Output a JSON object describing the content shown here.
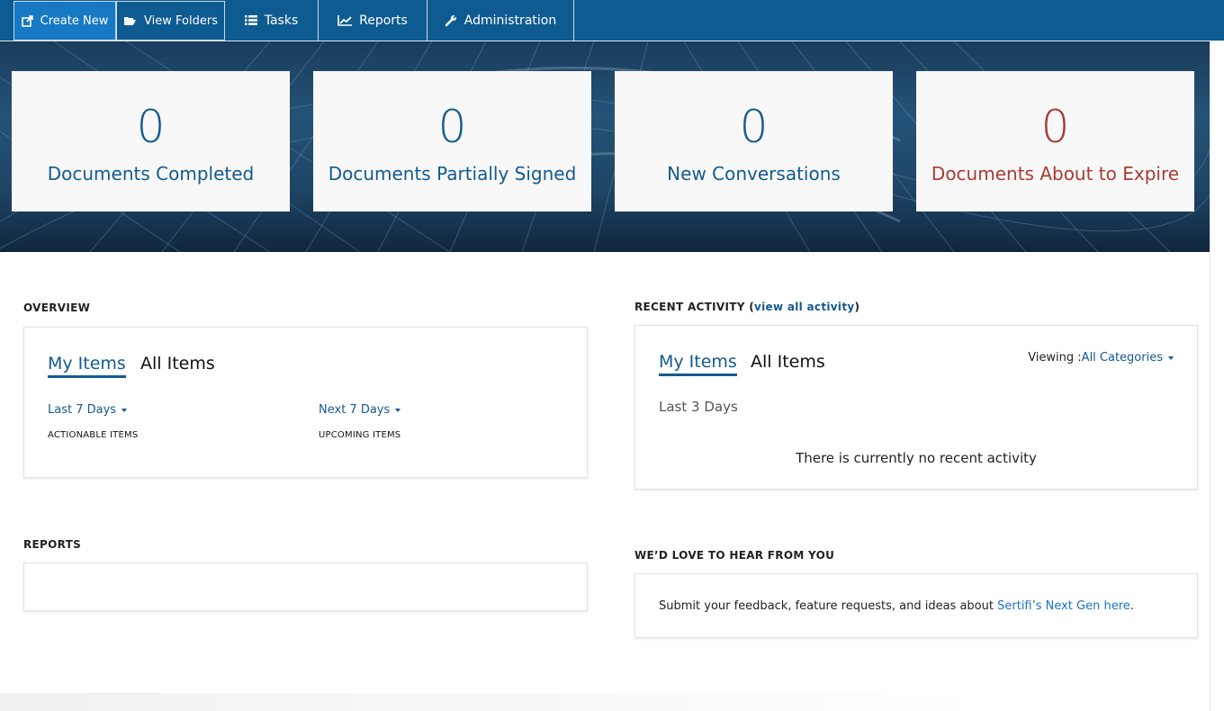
{
  "nav": {
    "create_new": "Create New",
    "view_folders": "View Folders",
    "tasks": "Tasks",
    "reports": "Reports",
    "administration": "Administration"
  },
  "stats": [
    {
      "value": "0",
      "label": "Documents Completed"
    },
    {
      "value": "0",
      "label": "Documents Partially Signed"
    },
    {
      "value": "0",
      "label": "New Conversations"
    },
    {
      "value": "0",
      "label": "Documents About to Expire"
    }
  ],
  "overview": {
    "title": "OVERVIEW",
    "tab_my": "My Items",
    "tab_all": "All Items",
    "range_left": "Last 7 Days",
    "range_right": "Next 7 Days",
    "caption_left": "ACTIONABLE ITEMS",
    "caption_right": "UPCOMING ITEMS"
  },
  "recent": {
    "title": "RECENT ACTIVITY (",
    "link": "view all activity",
    "title_end": ")",
    "tab_my": "My Items",
    "tab_all": "All Items",
    "viewing_label": "Viewing :",
    "viewing_value": "All Categories",
    "range": "Last 3 Days",
    "empty": "There is currently no recent activity"
  },
  "reports": {
    "title": "REPORTS"
  },
  "feedback": {
    "title": "WE’D LOVE TO HEAR FROM YOU",
    "text": "Submit your feedback, feature requests, and ideas about ",
    "link": "Sertifi’s Next Gen here",
    "end": "."
  },
  "colors": {
    "nav_bg": "#0e5b92",
    "nav_active": "#1779c4",
    "accent": "#14598f",
    "warning": "#a93a32"
  }
}
